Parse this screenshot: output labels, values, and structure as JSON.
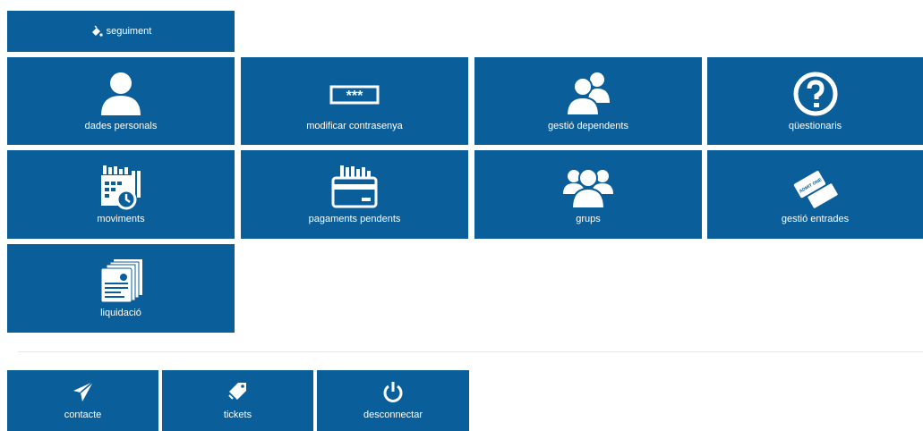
{
  "tiles": {
    "seguiment": "seguiment",
    "dades_personals": "dades personals",
    "modificar_contrasenya": "modificar contrasenya",
    "gestio_dependents": "gestió dependents",
    "questionaris": "qüestionaris",
    "moviments": "moviments",
    "pagaments_pendents": "pagaments pendents",
    "grups": "grups",
    "gestio_entrades": "gestió entrades",
    "liquidacio": "liquidació"
  },
  "footer": {
    "contacte": "contacte",
    "tickets": "tickets",
    "desconnectar": "desconnectar"
  },
  "password_mask": "***",
  "ticket_text": "ADMIT ONE",
  "colors": {
    "tile": "#0a5e99",
    "icon": "#ffffff"
  }
}
